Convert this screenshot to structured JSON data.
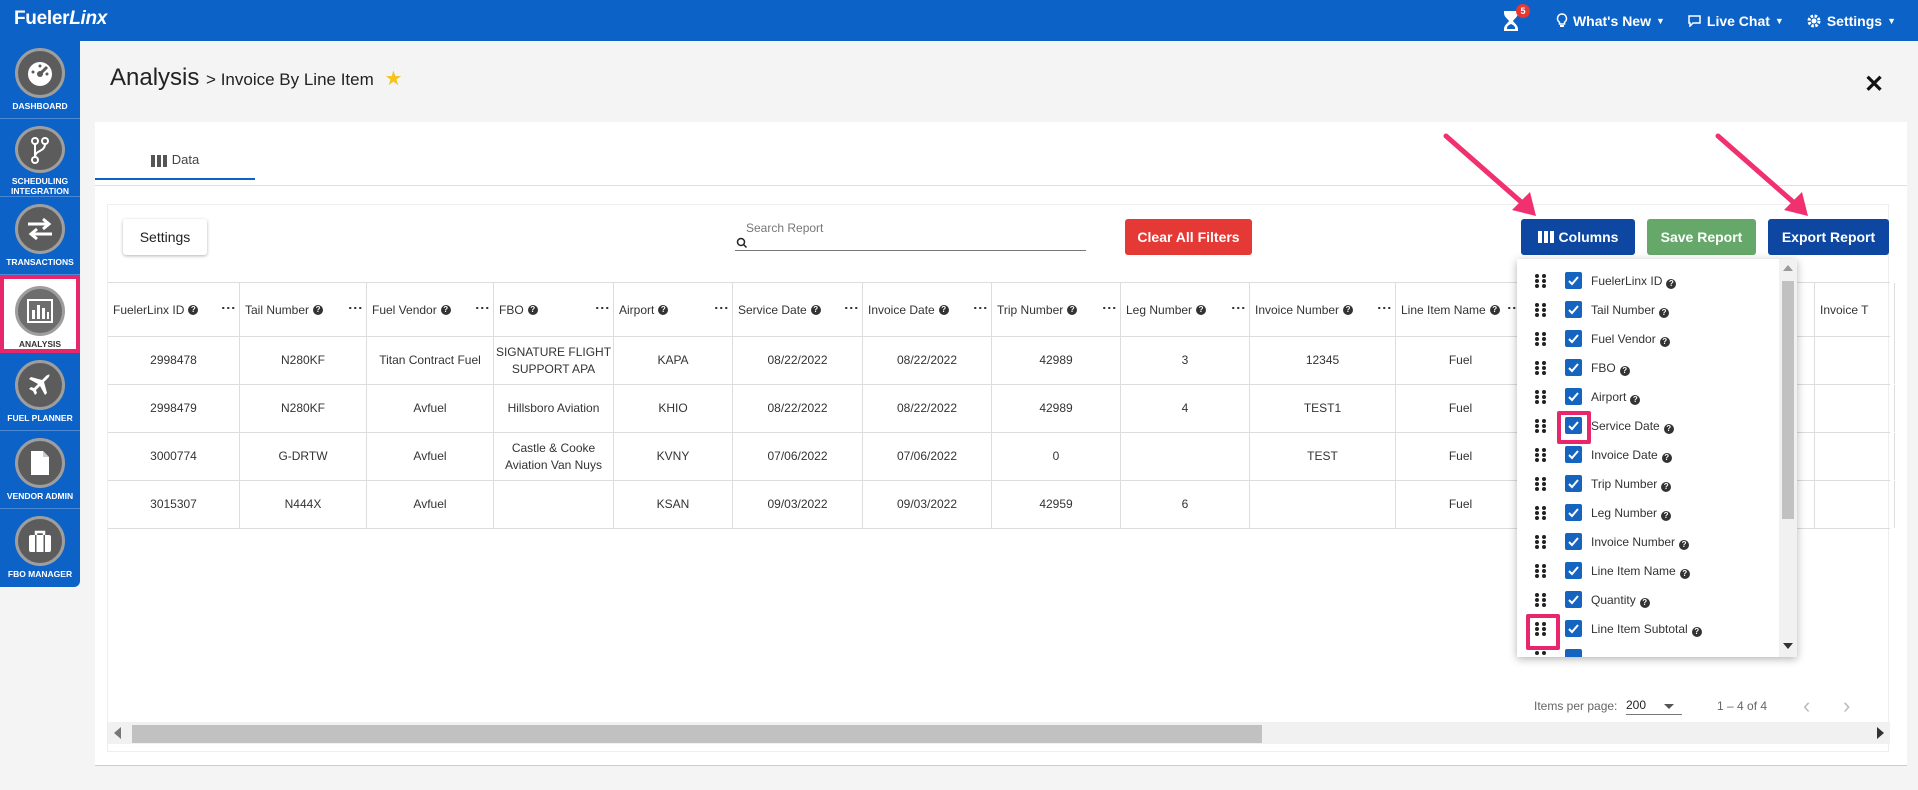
{
  "app": {
    "brand_main": "Fueler",
    "brand_italic": "Linx",
    "notification_count": "5",
    "whats_new": "What's New",
    "live_chat": "Live Chat",
    "settings": "Settings"
  },
  "sidebar": {
    "items": [
      {
        "label": "DASHBOARD",
        "icon": "gauge-icon"
      },
      {
        "label": "SCHEDULING INTEGRATION",
        "icon": "branch-icon"
      },
      {
        "label": "TRANSACTIONS",
        "icon": "swap-arrows-icon"
      },
      {
        "label": "ANALYSIS",
        "icon": "bar-chart-icon",
        "active": true
      },
      {
        "label": "FUEL PLANNER",
        "icon": "airplane-icon"
      },
      {
        "label": "VENDOR ADMIN",
        "icon": "document-icon"
      },
      {
        "label": "FBO MANAGER",
        "icon": "briefcase-icon"
      }
    ]
  },
  "page": {
    "title": "Analysis",
    "subtitle": "> Invoice By Line Item",
    "tab_label": "Data"
  },
  "toolbar": {
    "settings_label": "Settings",
    "search_placeholder": "Search Report",
    "clear_label": "Clear All Filters",
    "columns_label": "Columns",
    "save_label": "Save Report",
    "export_label": "Export Report"
  },
  "table": {
    "headers": [
      "FuelerLinx ID",
      "Tail Number",
      "Fuel Vendor",
      "FBO",
      "Airport",
      "Service Date",
      "Invoice Date",
      "Trip Number",
      "Leg Number",
      "Invoice Number",
      "Line Item Name",
      "",
      "Invoice T"
    ],
    "rows": [
      [
        "2998478",
        "N280KF",
        "Titan Contract Fuel",
        "SIGNATURE FLIGHT SUPPORT APA",
        "KAPA",
        "08/22/2022",
        "08/22/2022",
        "42989",
        "3",
        "12345",
        "Fuel"
      ],
      [
        "2998479",
        "N280KF",
        "Avfuel",
        "Hillsboro Aviation",
        "KHIO",
        "08/22/2022",
        "08/22/2022",
        "42989",
        "4",
        "TEST1",
        "Fuel"
      ],
      [
        "3000774",
        "G-DRTW",
        "Avfuel",
        "Castle & Cooke Aviation Van Nuys",
        "KVNY",
        "07/06/2022",
        "07/06/2022",
        "0",
        "",
        "TEST",
        "Fuel"
      ],
      [
        "3015307",
        "N444X",
        "Avfuel",
        "",
        "KSAN",
        "09/03/2022",
        "09/03/2022",
        "42959",
        "6",
        "",
        "Fuel"
      ]
    ]
  },
  "pager": {
    "items_per_page_label": "Items per page:",
    "page_size": "200",
    "range": "1 – 4 of 4",
    "prev": "‹",
    "next": "›"
  },
  "columns_menu": {
    "items": [
      "FuelerLinx ID",
      "Tail Number",
      "Fuel Vendor",
      "FBO",
      "Airport",
      "Service Date",
      "Invoice Date",
      "Trip Number",
      "Leg Number",
      "Invoice Number",
      "Line Item Name",
      "Quantity",
      "Line Item Subtotal"
    ]
  },
  "colors": {
    "primary": "#0d62c7",
    "highlight": "#e8266c",
    "danger": "#e53935",
    "success": "#66a86a"
  }
}
